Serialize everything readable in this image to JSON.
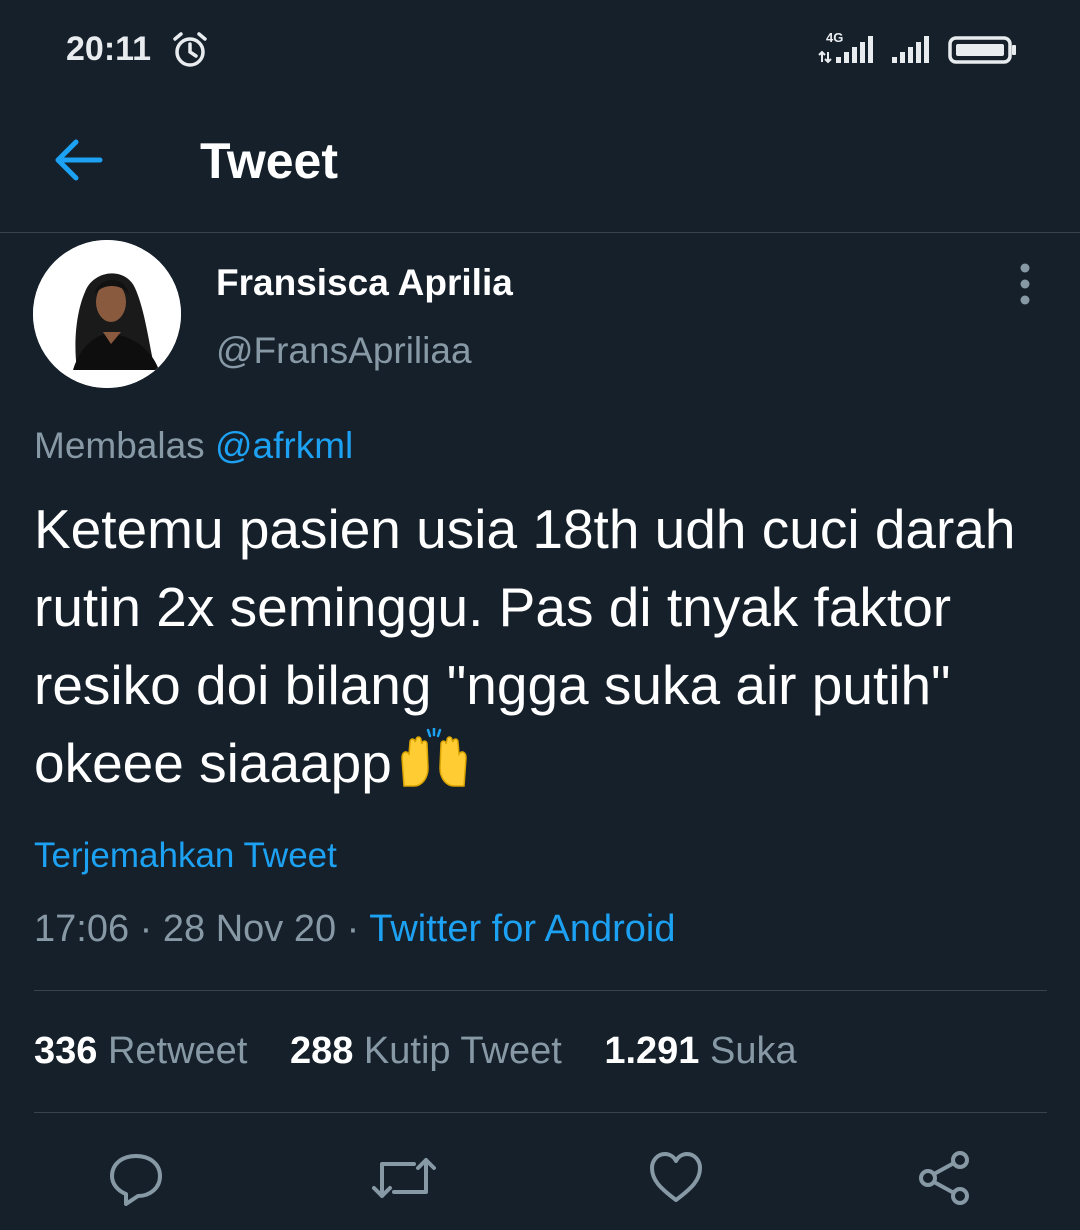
{
  "status_bar": {
    "time": "20:11",
    "network_label": "4G",
    "icons": [
      "alarm-icon",
      "signal-4g-icon",
      "signal-icon",
      "battery-icon"
    ]
  },
  "header": {
    "title": "Tweet",
    "back_icon": "arrow-left-icon"
  },
  "tweet": {
    "author": {
      "display_name": "Fransisca Aprilia",
      "handle": "@FransApriliaa"
    },
    "reply": {
      "prefix": "Membalas",
      "mention": "@afrkml"
    },
    "text": "Ketemu pasien usia 18th udh cuci darah rutin 2x seminggu. Pas di tnyak faktor resiko doi bilang \"ngga suka air putih\" okeee siaaapp",
    "emoji": "raising-hands",
    "translate_label": "Terjemahkan Tweet",
    "time": "17:06",
    "separator": " · ",
    "date": "28 Nov 20",
    "source": "Twitter for Android",
    "stats": {
      "retweets": "336",
      "retweets_label": "Retweet",
      "quotes": "288",
      "quotes_label": "Kutip Tweet",
      "likes": "1.291",
      "likes_label": "Suka"
    }
  },
  "actions": [
    "reply-icon",
    "retweet-icon",
    "like-icon",
    "share-icon"
  ],
  "colors": {
    "background": "#15202b",
    "accent": "#1da1f2",
    "secondary_text": "#8899a6",
    "divider": "#38444d"
  }
}
